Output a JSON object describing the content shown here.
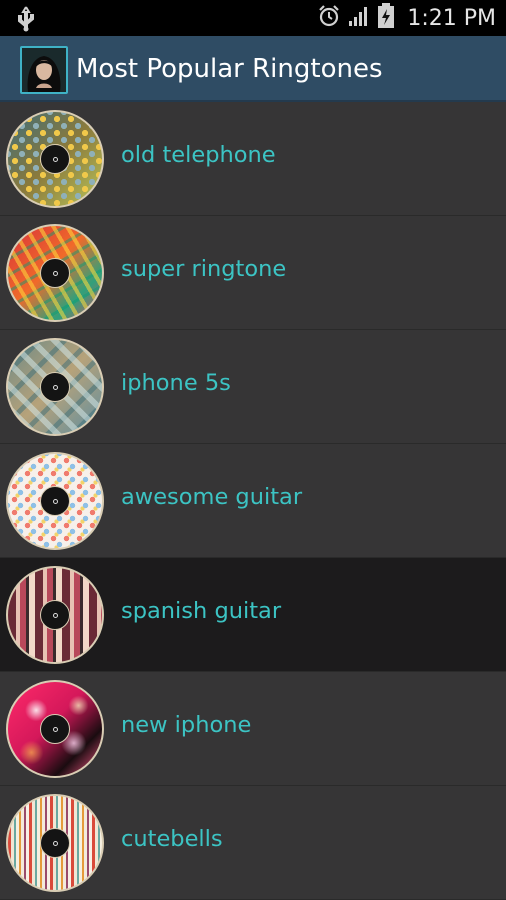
{
  "status_bar": {
    "time": "1:21 PM",
    "icons": [
      "usb-icon",
      "alarm-icon",
      "signal-icon",
      "battery-charging-icon"
    ]
  },
  "action_bar": {
    "title": "Most Popular Ringtones",
    "app_icon": "app-portrait-icon",
    "title_color": "#ffffff",
    "background": "#2f4c64"
  },
  "accent_color": "#3cc4c4",
  "ringtones": [
    {
      "label": "old telephone",
      "pattern": "p1"
    },
    {
      "label": "super ringtone",
      "pattern": "p2"
    },
    {
      "label": "iphone 5s",
      "pattern": "p3"
    },
    {
      "label": "awesome guitar",
      "pattern": "p4"
    },
    {
      "label": "spanish guitar",
      "pattern": "p5",
      "selected": true
    },
    {
      "label": "new iphone",
      "pattern": "p6"
    },
    {
      "label": "cutebells",
      "pattern": "p7"
    }
  ]
}
